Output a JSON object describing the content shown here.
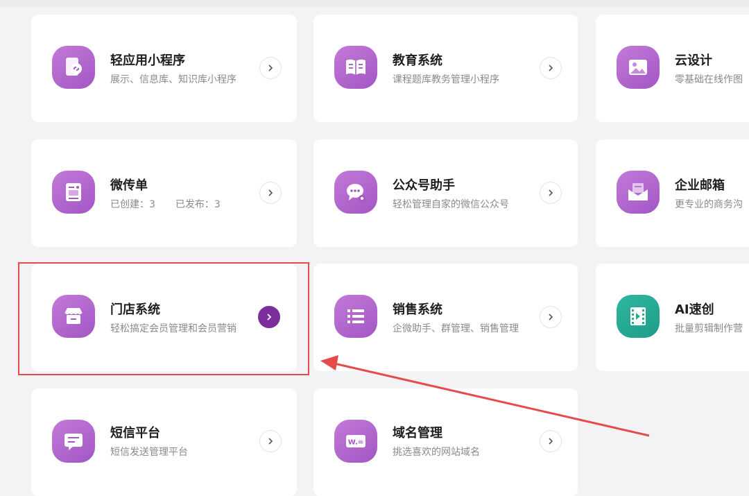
{
  "cards": [
    {
      "id": "light-app",
      "title": "轻应用小程序",
      "subtitle": "展示、信息库、知识库小程序",
      "icon": "miniprogram-icon"
    },
    {
      "id": "education",
      "title": "教育系统",
      "subtitle": "课程题库教务管理小程序",
      "icon": "book-icon"
    },
    {
      "id": "cloud-design",
      "title": "云设计",
      "subtitle": "零基础在线作图",
      "icon": "image-icon"
    },
    {
      "id": "micro-flyer",
      "title": "微传单",
      "subtitle": "已创建：3 已发布：3",
      "created_label": "已创建：",
      "created": "3",
      "published_label": "已发布：",
      "published": "3",
      "icon": "flyer-icon"
    },
    {
      "id": "official-account",
      "title": "公众号助手",
      "subtitle": "轻松管理自家的微信公众号",
      "icon": "wechat-icon"
    },
    {
      "id": "enterprise-mail",
      "title": "企业邮箱",
      "subtitle": "更专业的商务沟",
      "icon": "mail-icon"
    },
    {
      "id": "store-system",
      "title": "门店系统",
      "subtitle": "轻松搞定会员管理和会员营销",
      "icon": "store-icon"
    },
    {
      "id": "sales-system",
      "title": "销售系统",
      "subtitle": "企微助手、群管理、销售管理",
      "icon": "list-icon"
    },
    {
      "id": "ai-video",
      "title": "AI速创",
      "subtitle": "批量剪辑制作营",
      "icon": "video-icon"
    },
    {
      "id": "sms-platform",
      "title": "短信平台",
      "subtitle": "短信发送管理平台",
      "icon": "message-icon"
    },
    {
      "id": "domain-manage",
      "title": "域名管理",
      "subtitle": "挑选喜欢的网站域名",
      "icon": "domain-icon"
    }
  ],
  "colors": {
    "icon_purple": "#b068cf",
    "icon_teal": "#27a893",
    "active_arrow": "#7b2e9c",
    "highlight_red": "#e54b4b",
    "background": "#f3f3f5"
  }
}
